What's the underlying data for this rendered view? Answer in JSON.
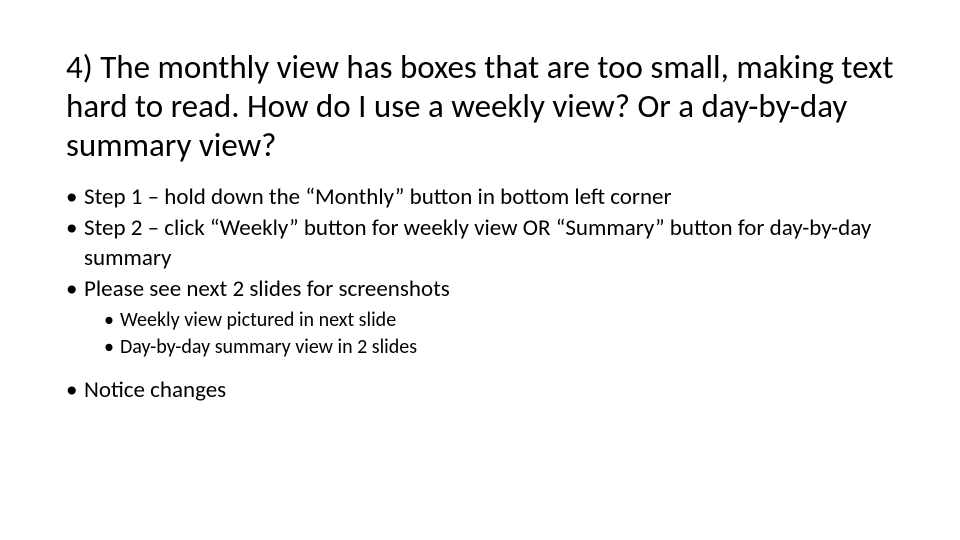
{
  "title": "4) The monthly view has boxes that are too small, making text hard to read. How do I use a weekly view? Or a day-by-day summary view?",
  "bullets": {
    "b1": "Step 1 – hold down the “Monthly” button in bottom left corner",
    "b2": "Step 2 – click “Weekly” button for weekly view OR “Summary” button for day-by-day summary",
    "b3": "Please see next 2 slides for screenshots",
    "b3a": "Weekly view pictured in next slide",
    "b3b": "Day-by-day summary view in 2 slides",
    "b4": "Notice changes"
  }
}
